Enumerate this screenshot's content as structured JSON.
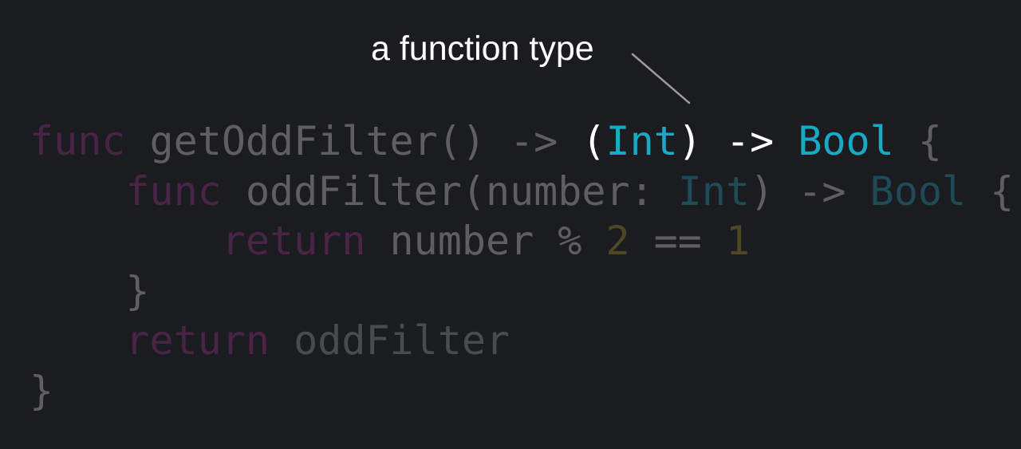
{
  "annotation": {
    "label": "a function type"
  },
  "code": {
    "line1": {
      "kw_func": "func",
      "name": " getOddFilter() ",
      "arrow": "->",
      "space": " ",
      "paren_open": "(",
      "type_int": "Int",
      "paren_close_arrow": ") -> ",
      "type_bool": "Bool",
      "brace": " {"
    },
    "line2": {
      "indent": "    ",
      "kw_func": "func",
      "name": " oddFilter(number: ",
      "type_int": "Int",
      "paren_arrow": ") -> ",
      "type_bool": "Bool",
      "brace": " {"
    },
    "line3": {
      "indent": "        ",
      "kw_return": "return",
      "expr": " number % ",
      "num_two": "2",
      "eq": " == ",
      "num_one": "1"
    },
    "line4": {
      "indent_brace": "    }"
    },
    "line5": {
      "indent": "    ",
      "kw_return": "return",
      "value": " oddFilter"
    },
    "line6": {
      "brace": "}"
    }
  },
  "colors": {
    "background": "#1b1c20",
    "highlight": "#ffffff",
    "type_highlight": "#1aa9c5",
    "keyword_dim": "#4a2446",
    "text_dim": "#5f5f63",
    "type_dim": "#1f4a57",
    "number_dim": "#4f4624"
  }
}
